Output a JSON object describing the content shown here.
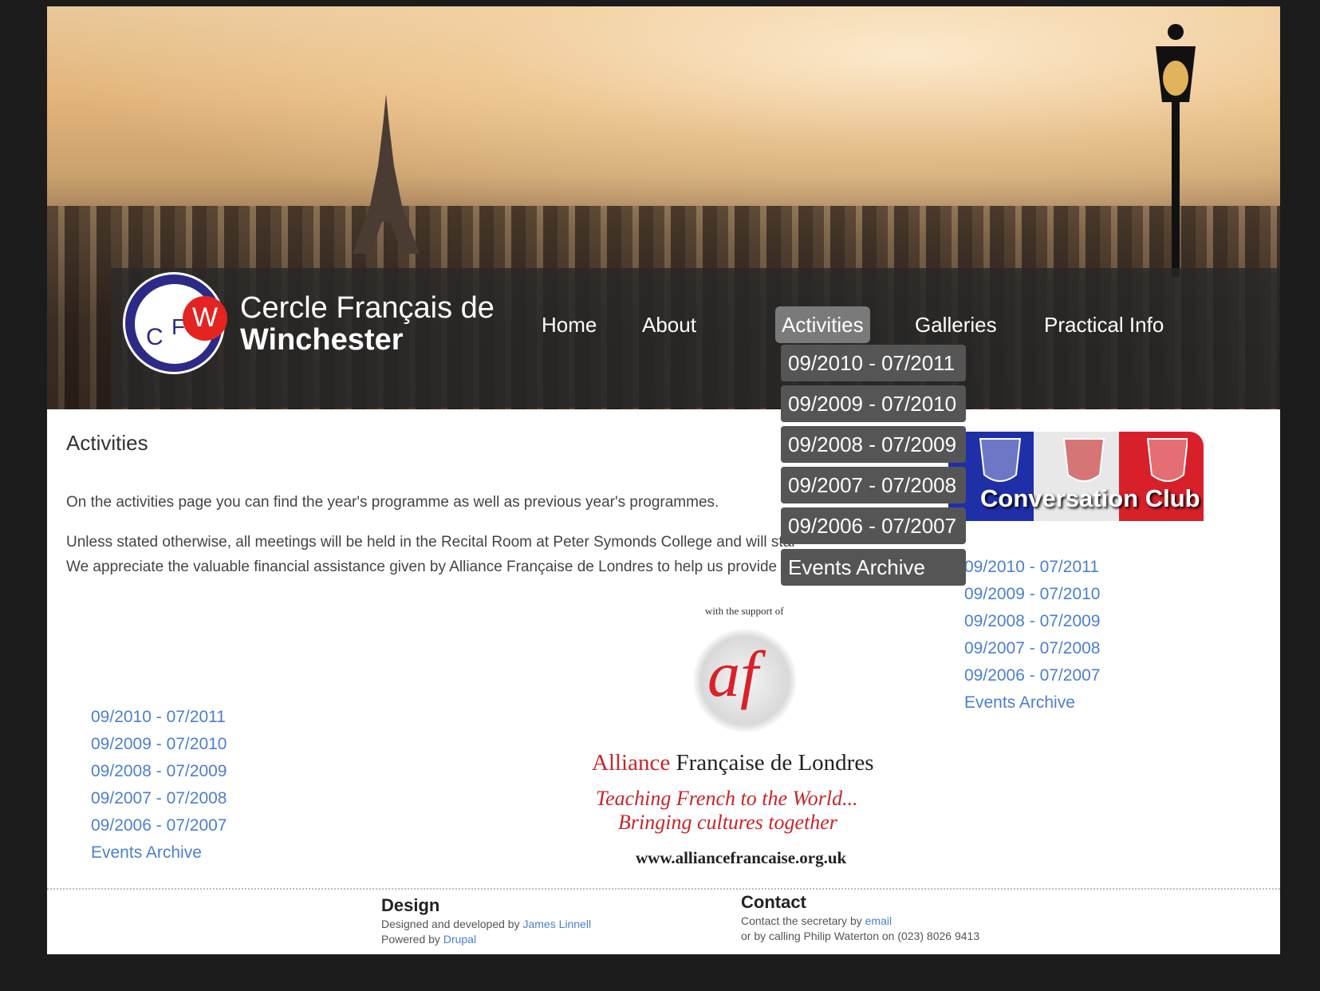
{
  "header": {
    "site_name_line1": "Cercle Français de",
    "site_name_line2": "Winchester",
    "logo_letters": {
      "c": "C",
      "f": "F",
      "w": "W"
    }
  },
  "nav": {
    "items": [
      {
        "label": "Home"
      },
      {
        "label": "About"
      },
      {
        "label": "Activities",
        "active": true
      },
      {
        "label": "Galleries"
      },
      {
        "label": "Practical Info"
      }
    ],
    "dropdown": [
      "09/2010 - 07/2011",
      "09/2009 - 07/2010",
      "09/2008 - 07/2009",
      "09/2007 - 07/2008",
      "09/2006 - 07/2007",
      "Events Archive"
    ]
  },
  "main": {
    "title": "Activities",
    "para1": "On the activities page you can find the year's programme as well as previous year's programmes.",
    "para2": "Unless stated otherwise, all meetings will be held in the Recital Room at Peter Symonds College and will star",
    "para3": "We appreciate the valuable financial assistance given by Alliance Française de Londres to help us provide the lec"
  },
  "left_links": [
    "09/2010 - 07/2011",
    "09/2009 - 07/2010",
    "09/2008 - 07/2009",
    "09/2007 - 07/2008",
    "09/2006 - 07/2007",
    "Events Archive"
  ],
  "sidebar": {
    "banner_text": "Conversation Club",
    "links": [
      "09/2010 - 07/2011",
      "09/2009 - 07/2010",
      "09/2008 - 07/2009",
      "09/2007 - 07/2008",
      "09/2006 - 07/2007",
      "Events Archive"
    ]
  },
  "alliance": {
    "support": "with the support of",
    "logo": "af",
    "name_red": "Alliance",
    "name_rest": "Française de Londres",
    "tagline1": "Teaching French to the World...",
    "tagline2": "Bringing cultures together",
    "url": "www.alliancefrancaise.org.uk"
  },
  "footer": {
    "design_heading": "Design",
    "design_line1_prefix": "Designed and developed by",
    "design_line1_link": "James Linnell",
    "design_line2_prefix": "Powered by",
    "design_line2_link": "Drupal",
    "contact_heading": "Contact",
    "contact_line1_prefix": "Contact the secretary by",
    "contact_line1_link": "email",
    "contact_line2": "or by calling Philip Waterton on (023) 8026 9413"
  },
  "colors": {
    "link": "#4a7fd0",
    "nav_active_bg": "#7a7a7a",
    "dropdown_bg": "#555555",
    "flag_blue": "#1f2fa8",
    "flag_white": "#e8e8e8",
    "flag_red": "#d7202a"
  }
}
